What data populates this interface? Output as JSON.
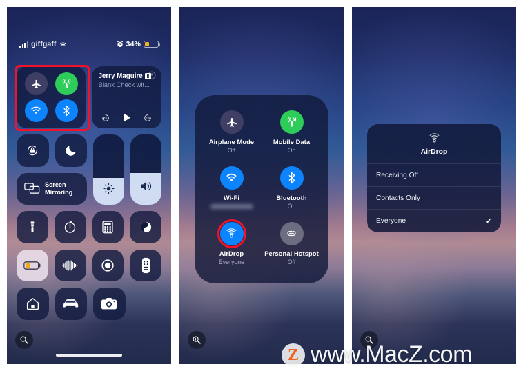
{
  "watermark": {
    "logo_letter": "Z",
    "text": "www.MacZ.com",
    "logo_color": "#f4601e"
  },
  "colors": {
    "accent_blue": "#0b84fe",
    "accent_green": "#2ecd5a",
    "inactive": "#3f3f66",
    "grey": "#6d6d82",
    "annotation_red": "#f4112a",
    "battery_amber": "#f2b424"
  },
  "panel1": {
    "name": "control-center-overview",
    "statusbar": {
      "carrier": "giffgaff",
      "signal_icon": "cellular-bars-icon",
      "wifi_icon": "wifi-icon",
      "alarm_icon": "alarm-clock-icon",
      "battery_percent": "34%",
      "battery_level": 34
    },
    "connectivity": {
      "airplane": {
        "label": "Airplane Mode",
        "state": "off",
        "icon": "airplane-icon"
      },
      "mobile_data": {
        "label": "Mobile Data",
        "state": "on",
        "icon": "cellular-antenna-icon"
      },
      "wifi": {
        "label": "Wi-Fi",
        "state": "on",
        "icon": "wifi-icon"
      },
      "bluetooth": {
        "label": "Bluetooth",
        "state": "on",
        "icon": "bluetooth-icon"
      }
    },
    "media": {
      "title": "Jerry Maguire",
      "subtitle": "Blank Check wit...",
      "badge_icon": "podcast-badge-icon",
      "airplay_icon": "airplay-icon",
      "back_icon": "skip-back-15-icon",
      "play_icon": "play-icon",
      "forward_icon": "skip-forward-15-icon"
    },
    "tiles": {
      "rotation_lock": {
        "label": "Rotation Lock",
        "icon": "rotation-lock-icon"
      },
      "do_not_disturb": {
        "label": "Do Not Disturb",
        "icon": "moon-icon"
      },
      "screen_mirroring": {
        "label_line1": "Screen",
        "label_line2": "Mirroring",
        "icon": "screen-mirroring-icon"
      },
      "brightness": {
        "label": "Brightness",
        "icon": "sun-icon",
        "value": 38
      },
      "volume": {
        "label": "Volume",
        "icon": "speaker-icon",
        "value": 45
      },
      "flashlight": {
        "label": "Flashlight",
        "icon": "flashlight-icon"
      },
      "timer": {
        "label": "Timer",
        "icon": "timer-icon"
      },
      "calculator": {
        "label": "Calculator",
        "icon": "calculator-icon"
      },
      "dark_mode": {
        "label": "Dark Mode",
        "icon": "contrast-circle-icon"
      },
      "low_power": {
        "label": "Low Power Mode",
        "icon": "battery-low-icon",
        "active": true
      },
      "shazam": {
        "label": "Music Recognition",
        "icon": "shazam-waveform-icon"
      },
      "screen_record": {
        "label": "Screen Recording",
        "icon": "record-circle-icon"
      },
      "apple_tv_remote": {
        "label": "Apple TV Remote",
        "icon": "remote-control-icon"
      },
      "home": {
        "label": "Home",
        "icon": "home-house-icon"
      },
      "carplay": {
        "label": "CarPlay",
        "icon": "car-icon"
      },
      "camera": {
        "label": "Camera",
        "icon": "camera-icon"
      }
    },
    "zoom_button": {
      "label": "Zoom in",
      "icon": "magnifier-plus-icon"
    },
    "home_indicator": "home-indicator-bar"
  },
  "panel2": {
    "name": "connectivity-expanded",
    "items": [
      {
        "label": "Airplane Mode",
        "state": "Off",
        "icon": "airplane-icon",
        "style": "off"
      },
      {
        "label": "Mobile Data",
        "state": "On",
        "icon": "cellular-antenna-icon",
        "style": "green"
      },
      {
        "label": "Wi-Fi",
        "state": "",
        "icon": "wifi-icon",
        "style": "blue",
        "state_blurred": true
      },
      {
        "label": "Bluetooth",
        "state": "On",
        "icon": "bluetooth-icon",
        "style": "blue"
      },
      {
        "label": "AirDrop",
        "state": "Everyone",
        "icon": "airdrop-icon",
        "style": "blue",
        "highlighted": true
      },
      {
        "label": "Personal Hotspot",
        "state": "Off",
        "icon": "hotspot-link-icon",
        "style": "grey"
      }
    ],
    "zoom_button": {
      "label": "Zoom in",
      "icon": "magnifier-plus-icon"
    }
  },
  "panel3": {
    "name": "airdrop-options-menu",
    "header": {
      "title": "AirDrop",
      "icon": "airdrop-icon"
    },
    "options": [
      {
        "label": "Receiving Off",
        "selected": false
      },
      {
        "label": "Contacts Only",
        "selected": false
      },
      {
        "label": "Everyone",
        "selected": true,
        "check_icon": "checkmark-icon"
      }
    ],
    "zoom_button": {
      "label": "Zoom in",
      "icon": "magnifier-plus-icon"
    }
  }
}
